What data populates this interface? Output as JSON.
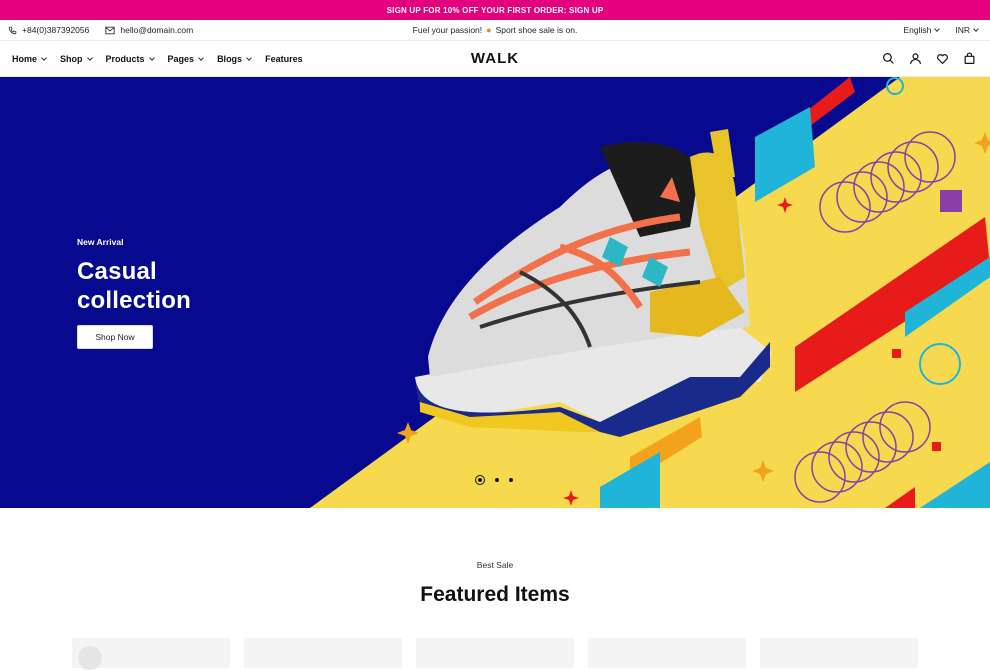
{
  "promo": {
    "text": "SIGN UP FOR 10% OFF YOUR FIRST ORDER: SIGN UP"
  },
  "topbar": {
    "phone": "+84(0)387392056",
    "email": "hello@domain.com",
    "tagline_start": "Fuel your passion!",
    "tagline_end": "Sport shoe sale is on.",
    "language": "English",
    "currency": "INR"
  },
  "nav": {
    "items": [
      {
        "label": "Home"
      },
      {
        "label": "Shop"
      },
      {
        "label": "Products"
      },
      {
        "label": "Pages"
      },
      {
        "label": "Blogs"
      },
      {
        "label": "Features"
      }
    ],
    "logo": "WALK"
  },
  "hero": {
    "eyebrow": "New Arrival",
    "title_line1": "Casual",
    "title_line2": "collection",
    "button": "Shop Now",
    "colors": {
      "navy": "#070a8e",
      "yellow": "#f6d94e",
      "magenta": "#e4007c"
    }
  },
  "featured": {
    "subtitle": "Best Sale",
    "title": "Featured Items"
  }
}
